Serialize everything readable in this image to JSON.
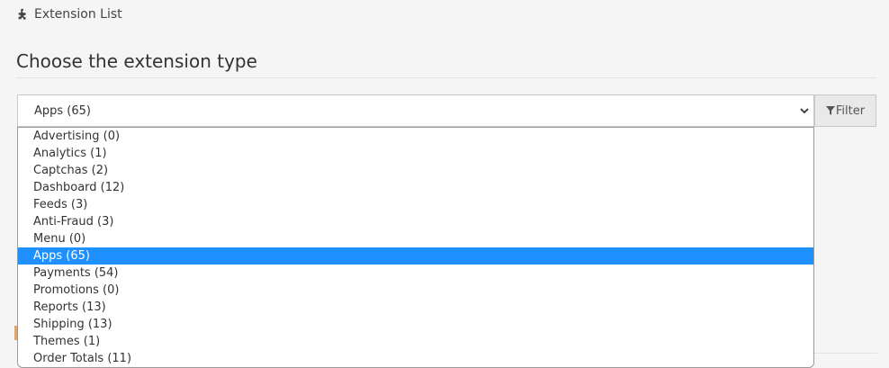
{
  "breadcrumb": {
    "icon": "puzzle-icon",
    "label": "Extension List"
  },
  "heading": "Choose the extension type",
  "select": {
    "value": "Apps (65)",
    "chevron": "chevron-down-icon",
    "options": [
      "Advertising (0)",
      "Analytics (1)",
      "Captchas (2)",
      "Dashboard (12)",
      "Feeds (3)",
      "Anti-Fraud (3)",
      "Menu (0)",
      "Apps (65)",
      "Payments (54)",
      "Promotions (0)",
      "Reports (13)",
      "Shipping (13)",
      "Themes (1)",
      "Order Totals (11)"
    ],
    "selected_index": 7
  },
  "filter_button": {
    "icon": "filter-icon",
    "label": "Filter"
  },
  "colors": {
    "highlight": "#1e90ff",
    "background": "#f5f5f6"
  }
}
